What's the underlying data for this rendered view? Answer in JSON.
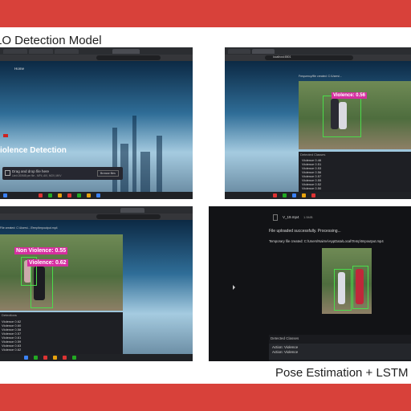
{
  "captions": {
    "top": "LO Detection Model",
    "bottom": "Pose Estimation + LSTM M"
  },
  "colors": {
    "band": "#d8413a",
    "label_bg": "#d62fa0",
    "bbox": "#4bdc4b"
  },
  "screens": {
    "s1": {
      "hero_title": "iolence Detection",
      "upload_label": "Drag and drop file here",
      "upload_hint": "Limit 200MB per file - MP4, AVI, MOV, MKV",
      "browse_label": "Browse files",
      "tab_label": "Home"
    },
    "s2": {
      "url": "localhost:8501",
      "frame_label": "Frequency/file created: C:\\Users\\...",
      "detection_tag": "Violence: 0.56",
      "section_label": "Detected Classes",
      "classes": [
        "Violence 0.46",
        "Violence 0.51",
        "Violence 0.53",
        "Violence 0.56",
        "Violence 0.57",
        "Violence 0.55",
        "Violence 0.52",
        "Violence 0.50",
        "Non Violence 0.54"
      ]
    },
    "s3": {
      "status_line": "File created: C:\\Users\\...\\Temp\\tmpoutput.mp4",
      "tag_nonviolence": "Non Violence: 0.55",
      "tag_violence": "Violence: 0.62",
      "section_label": "Detections",
      "classes": [
        "Violence 0.62",
        "Violence 0.60",
        "Violence 0.58",
        "Violence 0.57",
        "Violence 0.61",
        "Violence 0.59",
        "Violence 0.63",
        "Violence 0.62"
      ]
    },
    "s4": {
      "filename": "V_19.mp4",
      "filesize": "1.5MB",
      "upload_msg": "File uploaded successfully. Processing...",
      "temp_msg": "Temporary file created: C:\\Users\\Nairne\\AppData\\Local\\Temp\\tmpoutput.mp4",
      "section_label": "Detected Classes",
      "classes": [
        "Action: Violence",
        "Action: Violence"
      ]
    }
  }
}
